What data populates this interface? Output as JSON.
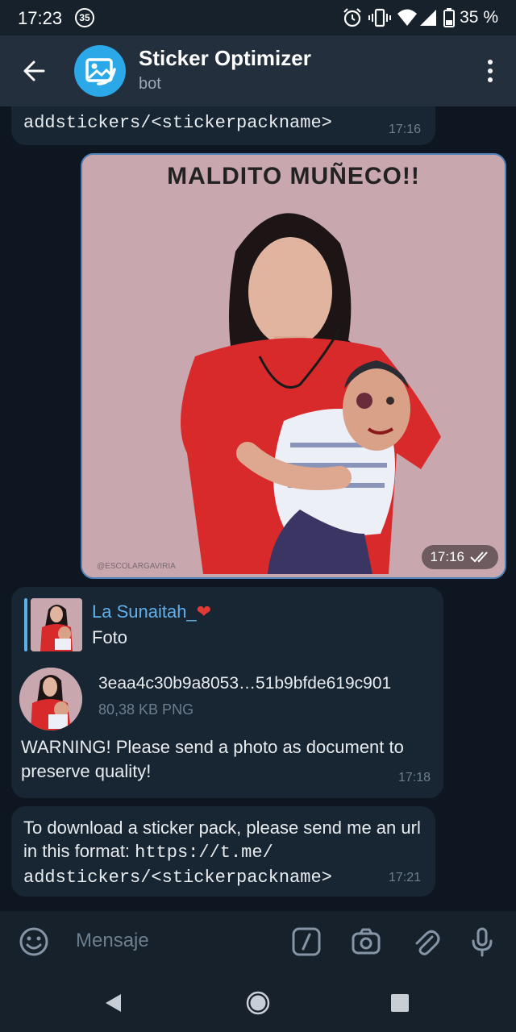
{
  "status_bar": {
    "time": "17:23",
    "notification_count": "35",
    "battery": "35 %"
  },
  "header": {
    "title": "Sticker Optimizer",
    "subtitle": "bot",
    "accent": "#2ba8e8"
  },
  "messages": {
    "m1": {
      "text_prefix": "addstickers/<stickerpackname>",
      "time": "17:16"
    },
    "photo": {
      "caption": "MALDITO MUÑECO!!",
      "watermark": "@ESCOLARGAVIRIA",
      "time": "17:16"
    },
    "m2": {
      "reply_name": "La Sunaitah_",
      "reply_type": "Foto",
      "file_name": "3eaa4c30b9a8053…51b9bfde619c901",
      "file_size": "80,38 KB PNG",
      "warning": "WARNING! Please send a photo as document to preserve quality!",
      "time": "17:18"
    },
    "m3": {
      "text_a": "To download a sticker pack, please send me an url in this format: ",
      "text_url": "https://t.me/",
      "text_b": "addstickers/<stickerpackname>",
      "time": "17:21"
    }
  },
  "input": {
    "placeholder": "Mensaje"
  }
}
